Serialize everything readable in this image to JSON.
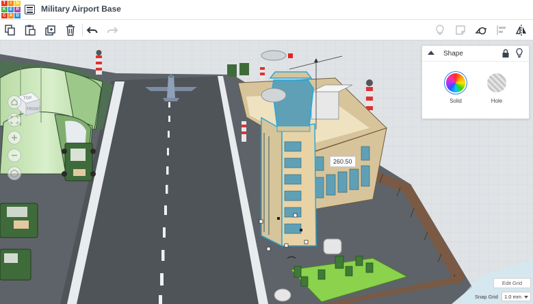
{
  "header": {
    "logo_letters": [
      "T",
      "I",
      "N",
      "K",
      "E",
      "R",
      "C",
      "A",
      "D"
    ],
    "logo_colors": [
      "#e63b2e",
      "#f08b1d",
      "#f7d117",
      "#45b54b",
      "#2f8fd8",
      "#9b4bb0",
      "#e63b2e",
      "#f08b1d",
      "#2f8fd8"
    ],
    "design_title": "Military Airport Base"
  },
  "toolbar": {
    "icons": [
      "copy-icon",
      "paste-icon",
      "duplicate-icon",
      "delete-icon",
      "undo-icon",
      "redo-icon",
      "light-bulb-icon",
      "note-icon",
      "workplane-icon",
      "align-icon",
      "mirror-icon"
    ]
  },
  "viewport": {
    "viewcube_top_label": "TOP",
    "viewcube_front_label": "FRONT",
    "dimension_value": "260.50",
    "nav_icons": [
      "home-icon",
      "fit-view-icon",
      "zoom-in-icon",
      "zoom-out-icon",
      "orthographic-icon"
    ]
  },
  "inspector": {
    "title": "Shape",
    "solid_label": "Solid",
    "hole_label": "Hole"
  },
  "grid": {
    "edit_grid_label": "Edit Grid",
    "snap_grid_label": "Snap Grid",
    "snap_grid_value": "1.0 mm"
  },
  "colors": {
    "accent": "#2c7be5",
    "selection": "#27a8d8",
    "tower": "#e8d3a6",
    "hangar": "#c7e6b4",
    "asphalt": "#585d63"
  }
}
